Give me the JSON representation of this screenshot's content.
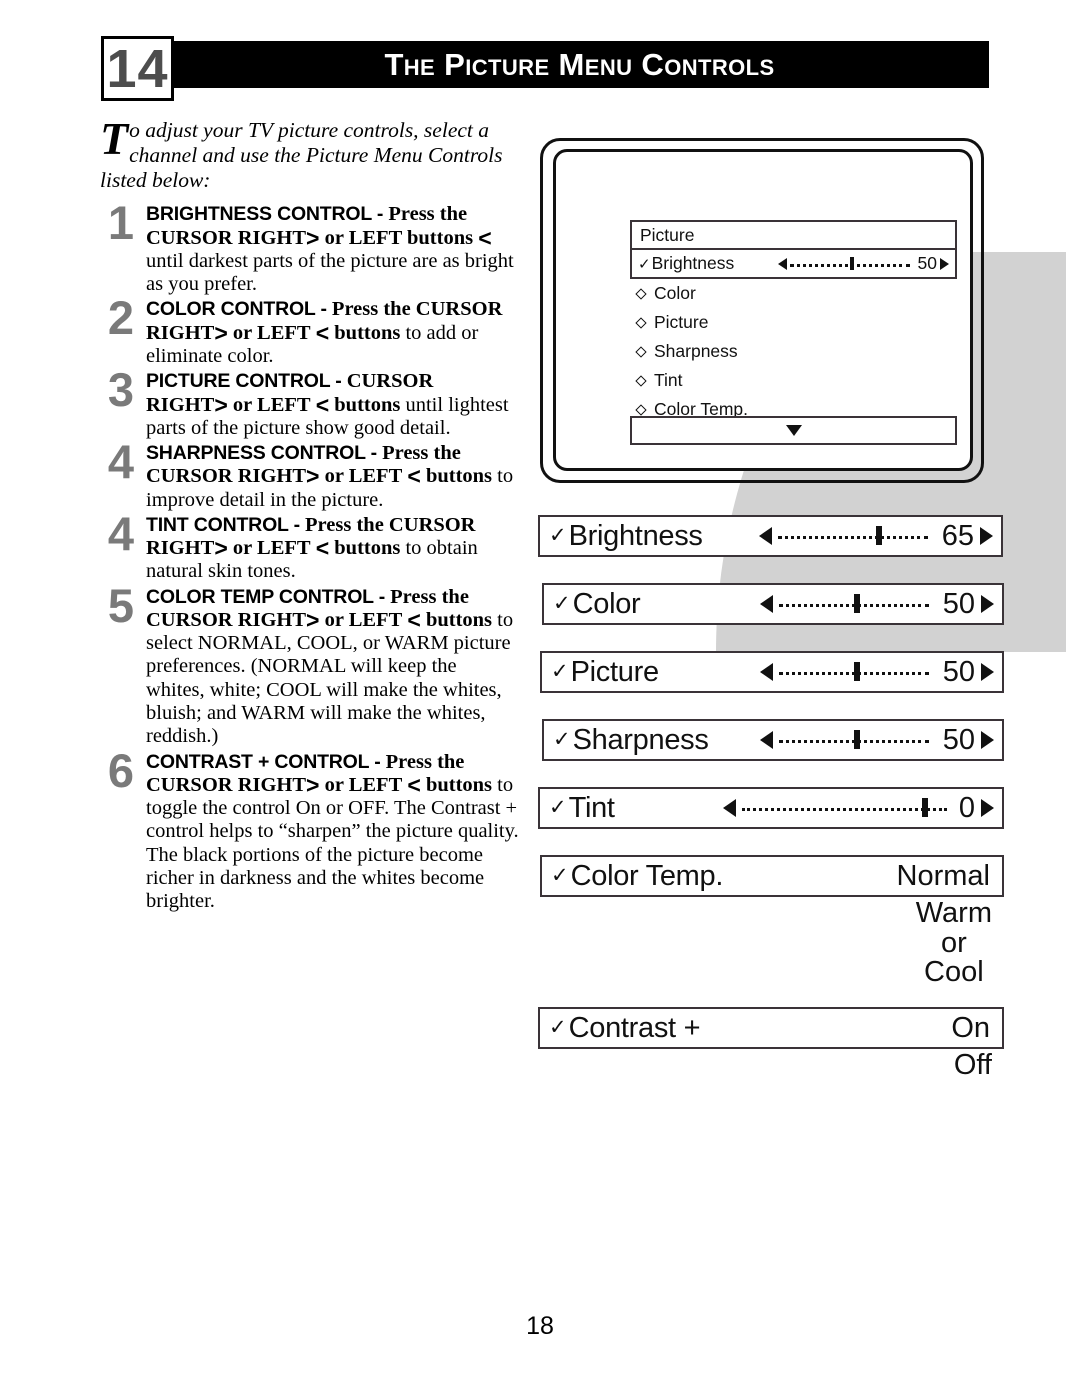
{
  "header": {
    "chapter": "14",
    "title": "The Picture Menu Controls"
  },
  "intro": {
    "dropcap": "T",
    "text": "o adjust your TV picture controls, select a channel and use the Picture Menu Controls listed below:"
  },
  "steps": [
    {
      "number": "1",
      "title": "BRIGHTNESS CONTROL -",
      "bold_lead": "Press the CURSOR RIGHT",
      "arrow_right": ">",
      "mid": "or LEFT buttons",
      "arrow_left": "<",
      "rest": "until darkest parts of the picture are as bright as you prefer."
    },
    {
      "number": "2",
      "title": "COLOR CONTROL -",
      "bold_lead": "Press the CURSOR RIGHT",
      "arrow_right": ">",
      "mid": "or LEFT",
      "arrow_left": "<",
      "bold_tail": "buttons",
      "rest": "to add or eliminate color."
    },
    {
      "number": "3",
      "title": "PICTURE CONTROL -",
      "bold_lead": "CURSOR RIGHT",
      "arrow_right": ">",
      "mid": "or LEFT",
      "arrow_left": "<",
      "bold_tail": "buttons",
      "rest": "until lightest parts of the picture show good detail."
    },
    {
      "number": "4",
      "title": "SHARPNESS CONTROL -",
      "bold_lead": "Press the CURSOR RIGHT",
      "arrow_right": ">",
      "mid": "or LEFT",
      "arrow_left": "<",
      "bold_tail": "buttons",
      "rest": "to improve detail in the picture."
    },
    {
      "number": "4",
      "title": "TINT CONTROL -",
      "bold_lead": "Press the CURSOR RIGHT",
      "arrow_right": ">",
      "mid": "or LEFT",
      "arrow_left": "<",
      "bold_tail": "buttons",
      "rest": "to obtain natural skin tones."
    },
    {
      "number": "5",
      "title": "COLOR TEMP CONTROL -",
      "bold_lead": "Press the CURSOR RIGHT",
      "arrow_right": ">",
      "mid": "or LEFT",
      "arrow_left": "<",
      "bold_tail": "buttons",
      "rest": "to select NORMAL, COOL, or WARM picture preferences. (NORMAL will keep the whites, white; COOL will make the whites, bluish; and WARM will make the whites, reddish.)"
    },
    {
      "number": "6",
      "title": "CONTRAST + CONTROL -",
      "bold_lead": "Press the CURSOR RIGHT",
      "arrow_right": ">",
      "mid": "or LEFT",
      "arrow_left": "<",
      "bold_tail": "buttons",
      "rest": "to toggle the control On or OFF. The Contrast + control helps to “sharpen” the picture quality. The black portions of the picture become richer in darkness and the whites become brighter."
    }
  ],
  "osd": {
    "title": "Picture",
    "scroll_up_icon": "caret-up-icon",
    "scroll_down_icon": "caret-down-icon",
    "selected": {
      "check_icon": "check-icon",
      "label": "Brightness",
      "value": "50",
      "percent": 50,
      "left_icon": "triangle-left-icon",
      "right_icon": "triangle-right-icon"
    },
    "items": [
      {
        "bullet_icon": "diamond-icon",
        "label": "Color"
      },
      {
        "bullet_icon": "diamond-icon",
        "label": "Picture"
      },
      {
        "bullet_icon": "diamond-icon",
        "label": "Sharpness"
      },
      {
        "bullet_icon": "diamond-icon",
        "label": "Tint"
      },
      {
        "bullet_icon": "diamond-icon",
        "label": "Color Temp."
      }
    ]
  },
  "callouts": [
    {
      "check_icon": "check-icon",
      "label": "Brightness",
      "value": "65",
      "percent": 65,
      "kind": "slider"
    },
    {
      "check_icon": "check-icon",
      "label": "Color",
      "value": "50",
      "percent": 50,
      "kind": "slider"
    },
    {
      "check_icon": "check-icon",
      "label": "Picture",
      "value": "50",
      "percent": 50,
      "kind": "slider"
    },
    {
      "check_icon": "check-icon",
      "label": "Sharpness",
      "value": "50",
      "percent": 50,
      "kind": "slider"
    },
    {
      "check_icon": "check-icon",
      "label": "Tint",
      "value": "0",
      "percent": 88,
      "kind": "slider"
    },
    {
      "check_icon": "check-icon",
      "label": "Color Temp.",
      "value": "Normal",
      "kind": "option",
      "alternatives": "Warm\nor\nCool"
    },
    {
      "check_icon": "check-icon",
      "label": "Contrast +",
      "value": "On",
      "kind": "option",
      "alternatives": "Off"
    }
  ],
  "page_number": "18"
}
